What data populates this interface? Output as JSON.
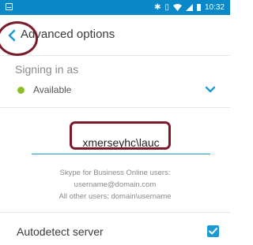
{
  "status_bar": {
    "time": "10:32",
    "icons": [
      "app-notification-icon",
      "bluetooth-icon",
      "vibrate-icon",
      "wifi-icon",
      "signal-icon",
      "battery-icon"
    ]
  },
  "header": {
    "title": "Advanced options",
    "back_icon": "chevron-left-icon"
  },
  "signing_in": {
    "label": "Signing in as",
    "status": "Available",
    "status_color": "#8fbd28",
    "dropdown_icon": "chevron-down-icon"
  },
  "username_field": {
    "value": "xmerseyhc\\lauc"
  },
  "hint": {
    "line1": "Skype for Business Online users:",
    "line2": "username@domain.com",
    "line3": "All other users: domain\\username"
  },
  "autodetect": {
    "label": "Autodetect server",
    "checked": true
  },
  "colors": {
    "accent": "#1c9ad6",
    "status_bar": "#0a88c8",
    "annotation": "#7a1a2c"
  }
}
